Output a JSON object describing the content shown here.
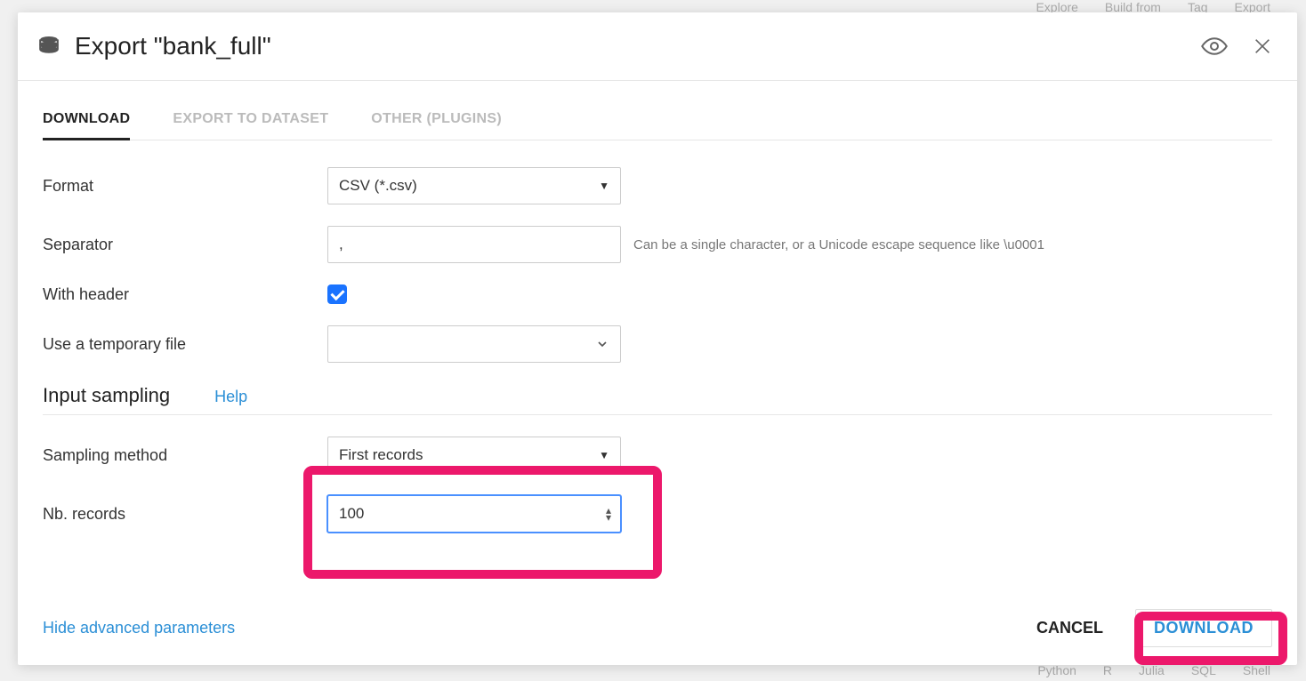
{
  "background": {
    "top_items": [
      "Explore",
      "Build from",
      "Tag",
      "Export"
    ],
    "bottom_items": [
      "Python",
      "R",
      "Julia",
      "SQL",
      "Shell"
    ]
  },
  "modal": {
    "title": "Export \"bank_full\"",
    "tabs": {
      "download": "DOWNLOAD",
      "export_dataset": "EXPORT TO DATASET",
      "other_plugins": "OTHER (PLUGINS)"
    },
    "form": {
      "format_label": "Format",
      "format_value": "CSV (*.csv)",
      "separator_label": "Separator",
      "separator_value": ",",
      "separator_hint": "Can be a single character, or a Unicode escape sequence like \\u0001",
      "with_header_label": "With header",
      "with_header_checked": true,
      "tmp_file_label": "Use a temporary file",
      "tmp_file_value": ""
    },
    "sampling": {
      "section_title": "Input sampling",
      "help_label": "Help",
      "method_label": "Sampling method",
      "method_value": "First records",
      "nb_records_label": "Nb. records",
      "nb_records_value": "100"
    },
    "footer": {
      "hide_adv": "Hide advanced parameters",
      "cancel": "CANCEL",
      "download": "DOWNLOAD"
    }
  }
}
